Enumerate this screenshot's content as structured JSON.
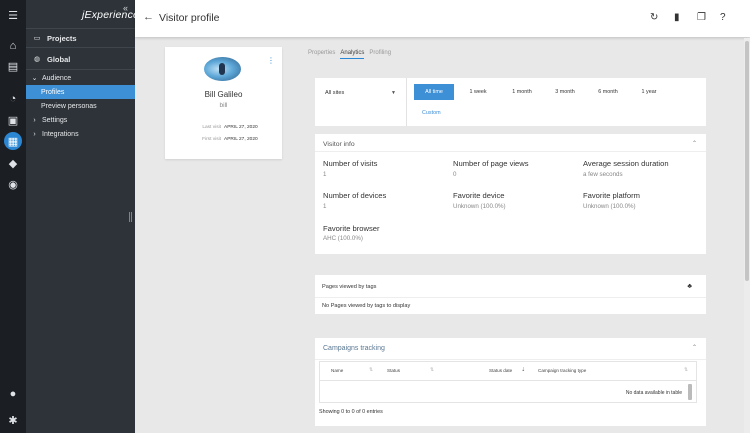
{
  "rail": {
    "icons": [
      "hamburger-icon",
      "home-icon",
      "clipboard-icon",
      "gauge-icon",
      "image-icon",
      "calendar-icon",
      "tag-icon",
      "compass-icon",
      "user-icon",
      "gear-icon"
    ]
  },
  "sidebar": {
    "logo": "jExperience",
    "projects_label": "Projects",
    "global_label": "Global",
    "items": [
      {
        "label": "Audience",
        "prefix": "⌄"
      },
      {
        "label": "Profiles",
        "prefix": ""
      },
      {
        "label": "Preview personas",
        "prefix": ""
      },
      {
        "label": "Settings",
        "prefix": "›"
      },
      {
        "label": "Integrations",
        "prefix": "›"
      }
    ]
  },
  "header": {
    "title": "Visitor profile"
  },
  "profile": {
    "name": "Bill Galileo",
    "username": "bill",
    "last_visit_label": "Last visit",
    "last_visit": "APRIL 27, 2020",
    "first_visit_label": "First visit",
    "first_visit": "APRIL 27, 2020"
  },
  "tabs": [
    "Properties",
    "Analytics",
    "Profiling"
  ],
  "filter": {
    "site": "All sites",
    "periods": [
      "All time",
      "1 week",
      "1 month",
      "3 month",
      "6 month",
      "1 year"
    ],
    "custom": "Custom"
  },
  "visitor_info": {
    "title": "Visitor info",
    "stats": [
      {
        "label": "Number of visits",
        "value": "1"
      },
      {
        "label": "Number of page views",
        "value": "0"
      },
      {
        "label": "Average session duration",
        "value": "a few seconds"
      },
      {
        "label": "Number of devices",
        "value": "1"
      },
      {
        "label": "Favorite device",
        "value": "Unknown (100.0%)"
      },
      {
        "label": "Favorite platform",
        "value": "Unknown (100.0%)"
      },
      {
        "label": "Favorite browser",
        "value": "AHC (100.0%)"
      }
    ]
  },
  "pages_viewed": {
    "title": "Pages viewed by tags",
    "empty": "No Pages viewed by tags to display"
  },
  "campaigns": {
    "title": "Campaigns tracking",
    "columns": [
      "Name",
      "Status",
      "Status date",
      "Campaign tracking type"
    ],
    "empty": "No data available in table",
    "showing": "Showing 0 to 0 of 0 entries"
  }
}
